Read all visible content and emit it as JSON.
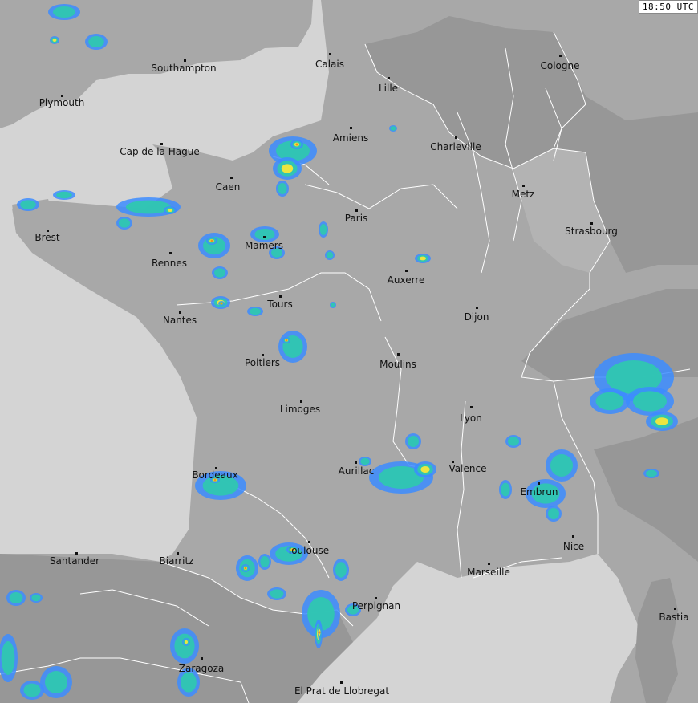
{
  "timestamp": "18:50 UTC",
  "colors": {
    "sea": "#d4d4d4",
    "land": "#a8a8a8",
    "land_dark": "#979797",
    "border": "#ffffff",
    "radar_low": "#3c8cff",
    "radar_mid": "#2fc7b0",
    "radar_high": "#f5e83a",
    "radar_peak": "#f08a20"
  },
  "cities": {
    "southampton": "Southampton",
    "calais": "Calais",
    "cologne": "Cologne",
    "lille": "Lille",
    "plymouth": "Plymouth",
    "amiens": "Amiens",
    "charleville": "Charleville",
    "cap_de_la_hague": "Cap de la Hague",
    "caen": "Caen",
    "metz": "Metz",
    "paris": "Paris",
    "strasbourg": "Strasbourg",
    "brest": "Brest",
    "mamers": "Mamers",
    "rennes": "Rennes",
    "auxerre": "Auxerre",
    "tours": "Tours",
    "nantes": "Nantes",
    "dijon": "Dijon",
    "poitiers": "Poitiers",
    "moulins": "Moulins",
    "limoges": "Limoges",
    "lyon": "Lyon",
    "aurillac": "Aurillac",
    "valence": "Valence",
    "bordeaux": "Bordeaux",
    "embrun": "Embrun",
    "nice": "Nice",
    "santander": "Santander",
    "biarritz": "Biarritz",
    "toulouse": "Toulouse",
    "marseille": "Marseille",
    "perpignan": "Perpignan",
    "bastia": "Bastia",
    "zaragoza": "Zaragoza",
    "el_prat_de_llobregat": "El Prat de Llobregat"
  }
}
